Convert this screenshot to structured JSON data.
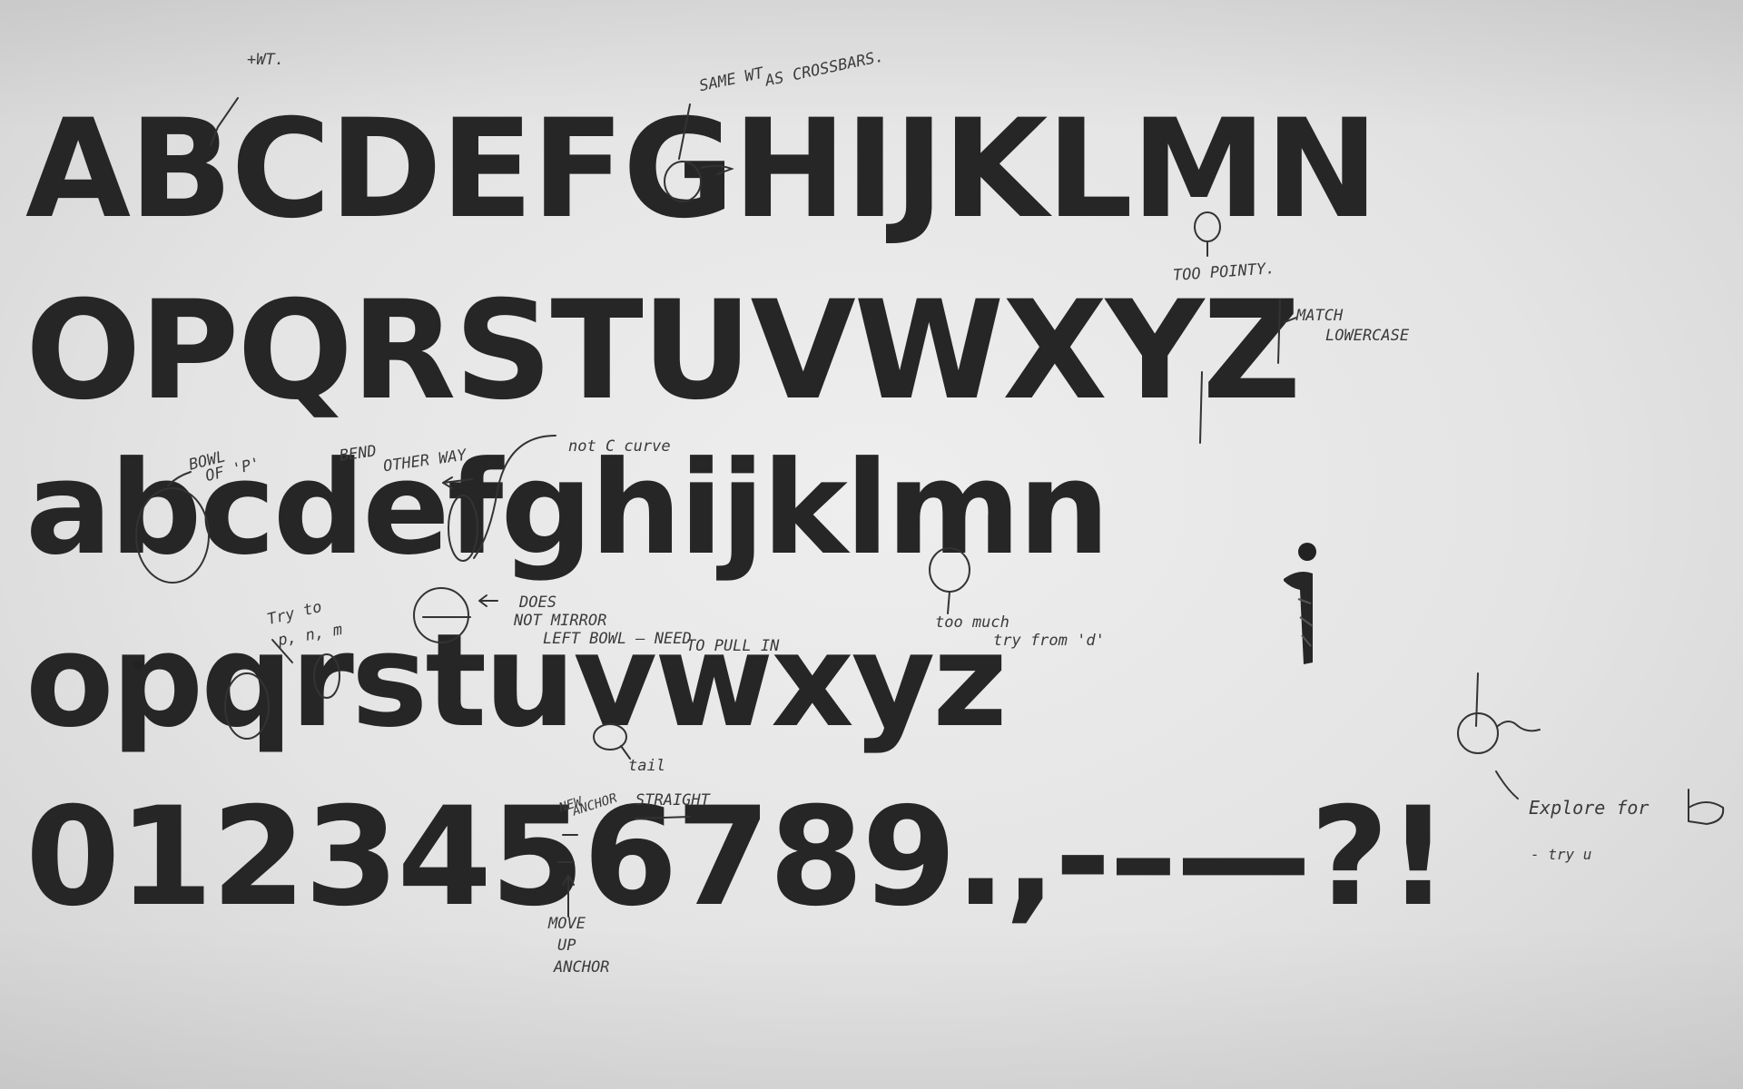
{
  "specimen": {
    "uppercase_1": "ABCDEFGHIJKLMN",
    "uppercase_2": "OPQRSTUVWXYZ",
    "lowercase_1": "abcdefghijklmn",
    "lowercase_2": "opqrstuvwxyz",
    "figures": "0123456789.,-–—?!"
  },
  "annotations": {
    "wt": "+WT.",
    "same_wt_1": "SAME WT",
    "same_wt_2": "AS CROSSBARS.",
    "too_pointy": "TOO POINTY.",
    "match_lowercase_1": "MATCH",
    "match_lowercase_2": "LOWERCASE",
    "bowl_of_p_1": "BOWL",
    "bowl_of_p_2": "OF 'P'",
    "bend_other_way_1": "BEND",
    "bend_other_way_2": "OTHER WAY",
    "not_c_curve": "not C curve",
    "does_not_mirror_1": "DOES",
    "does_not_mirror_2": "NOT MIRROR",
    "does_not_mirror_3": "LEFT BOWL — NEED",
    "does_not_mirror_4": "TO PULL IN",
    "try_pnm_1": "Try to",
    "try_pnm_2": "p, n, m",
    "too_much_1": "too much",
    "too_much_2": "try from 'd'",
    "tail": "tail",
    "new_anchor_1": "NEW",
    "new_anchor_2": "ANCHOR",
    "straight": "STRAIGHT",
    "move_up_anchor_1": "MOVE",
    "move_up_anchor_2": "UP",
    "move_up_anchor_3": "ANCHOR",
    "explore_1": "Explore for",
    "explore_2": "- try u"
  }
}
